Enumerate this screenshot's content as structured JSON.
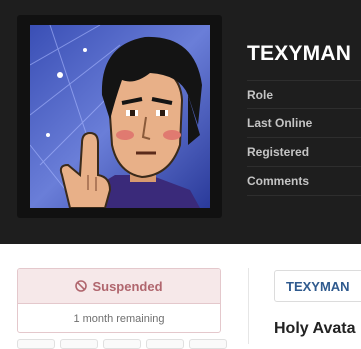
{
  "profile": {
    "username": "TEXYMAN",
    "meta_labels": [
      "Role",
      "Last Online",
      "Registered",
      "Comments"
    ]
  },
  "status": {
    "label": "Suspended",
    "remaining": "1 month remaining",
    "icon": "ban-icon"
  },
  "tabs": {
    "active": "TEXYMAN"
  },
  "content": {
    "title": "Holy Avata"
  },
  "colors": {
    "header_bg": "#1e1e1e",
    "status_text": "#b0666e",
    "status_bg": "#f6e8e9",
    "tab_text": "#2f5a8e"
  }
}
